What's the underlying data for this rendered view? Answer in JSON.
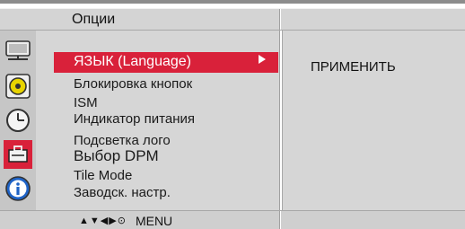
{
  "header": {
    "title": "Опции"
  },
  "icons": [
    "monitor-icon",
    "audio-disc-icon",
    "clock-icon",
    "toolbox-icon",
    "info-icon"
  ],
  "menu": {
    "items": [
      {
        "label": "ЯЗЫК (Language)",
        "selected": true
      },
      {
        "label": "Блокировка кнопок"
      },
      {
        "label": "ISM"
      },
      {
        "label": "Индикатор питания"
      },
      {
        "label": "Подсветка лого"
      },
      {
        "label": "Выбор DPM"
      },
      {
        "label": "Tile Mode"
      },
      {
        "label": "Заводск. настр."
      }
    ]
  },
  "submenu": {
    "apply_label": "ПРИМЕНИТЬ"
  },
  "footer": {
    "nav_glyphs": [
      "▲",
      "▼",
      "◀",
      "▶",
      "⊙"
    ],
    "menu_label": "MENU"
  },
  "colors": {
    "selection": "#d9213a",
    "panel": "#d6d6d6",
    "iconbar": "#c6c6c6"
  }
}
